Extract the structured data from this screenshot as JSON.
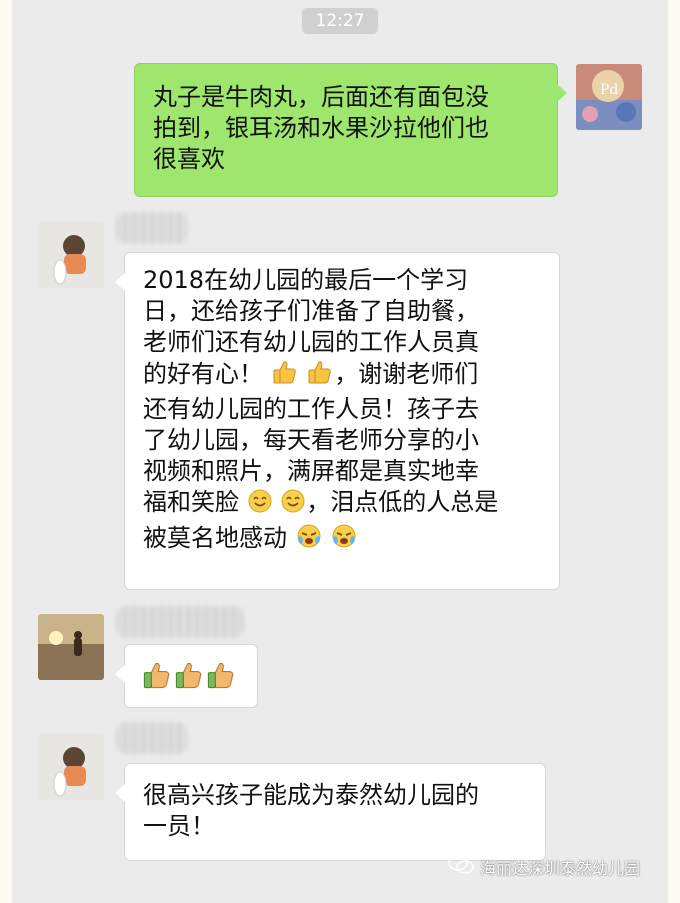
{
  "chat": {
    "timestamp": "12:27",
    "messages": [
      {
        "direction": "outgoing",
        "lines": [
          "丸子是牛肉丸，后面还有面包没",
          "拍到，银耳汤和水果沙拉他们也",
          "很喜欢"
        ]
      },
      {
        "direction": "incoming",
        "lines": [
          "2018在幼儿园的最后一个学习",
          "日，还给孩子们准备了自助餐，",
          "老师们还有幼儿园的工作人员真",
          "的好有心！",
          "，谢谢老师们",
          "还有幼儿园的工作人员！孩子去",
          "了幼儿园，每天看老师分享的小",
          "视频和照片，满屏都是真实地幸",
          "福和笑脸",
          "，泪点低的人总是",
          "被莫名地感动"
        ]
      },
      {
        "direction": "incoming",
        "emoji": [
          "thumbs-up-icon",
          "thumbs-up-icon",
          "thumbs-up-icon"
        ]
      },
      {
        "direction": "incoming",
        "lines": [
          "很高兴孩子能成为泰然幼儿园的",
          "一员！"
        ]
      }
    ]
  },
  "watermark": {
    "text": "海丽达深圳泰然幼儿园"
  },
  "colors": {
    "outgoing_bubble": "#9fe66e",
    "incoming_bubble": "#ffffff",
    "background": "#ebebeb"
  }
}
